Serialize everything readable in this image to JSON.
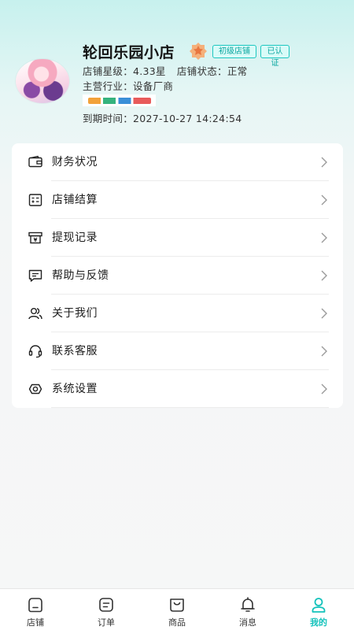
{
  "profile": {
    "shop_name": "轮回乐园小店",
    "badge_level": "初级店铺",
    "badge_cert": "已认证",
    "rating": "店铺星级：4.33星",
    "status": "店铺状态：正常",
    "industry": "主营行业：设备厂商",
    "expiry": "到期时间：2027-10-27 14:24:54"
  },
  "menu": {
    "items": [
      {
        "label": "财务状况",
        "icon": "wallet-icon"
      },
      {
        "label": "店铺结算",
        "icon": "settlement-icon"
      },
      {
        "label": "提现记录",
        "icon": "withdraw-icon"
      },
      {
        "label": "帮助与反馈",
        "icon": "feedback-icon"
      },
      {
        "label": "关于我们",
        "icon": "people-icon"
      },
      {
        "label": "联系客服",
        "icon": "headset-icon"
      },
      {
        "label": "系统设置",
        "icon": "gear-icon"
      }
    ]
  },
  "tabbar": {
    "items": [
      {
        "label": "店铺",
        "icon": "shop-icon"
      },
      {
        "label": "订单",
        "icon": "order-icon"
      },
      {
        "label": "商品",
        "icon": "product-icon"
      },
      {
        "label": "消息",
        "icon": "bell-icon"
      },
      {
        "label": "我的",
        "icon": "user-icon",
        "active": true
      }
    ]
  },
  "colors": {
    "accent": "#14c2bb",
    "badge_border": "#1cc7c0",
    "header_top": "#c7f1ee",
    "background": "#f6f7f7"
  }
}
